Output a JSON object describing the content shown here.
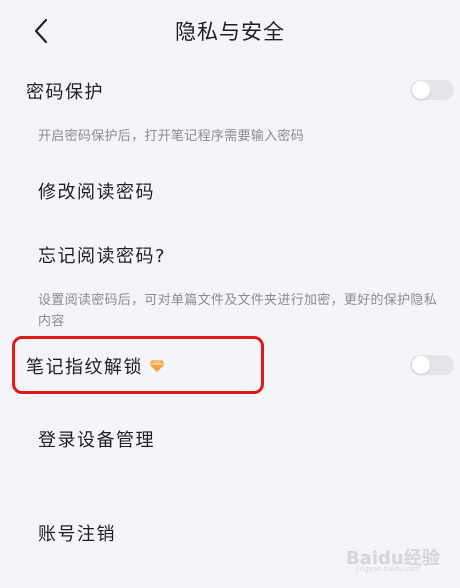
{
  "header": {
    "title": "隐私与安全",
    "back_icon": "chevron-left-icon"
  },
  "items": {
    "password_protection": {
      "label": "密码保护",
      "toggle_on": false,
      "description": "开启密码保护后，打开笔记程序需要输入密码"
    },
    "change_read_password": {
      "label": "修改阅读密码"
    },
    "forgot_read_password": {
      "label": "忘记阅读密码?",
      "description": "设置阅读密码后，可对单篇文件及文件夹进行加密，更好的保护隐私内容"
    },
    "fingerprint_unlock": {
      "label": "笔记指纹解锁",
      "badge_icon": "vip-diamond-icon",
      "toggle_on": false
    },
    "device_management": {
      "label": "登录设备管理"
    },
    "account_cancel": {
      "label": "账号注销"
    }
  },
  "watermark": {
    "text": "Baidu经验",
    "sub": "jingyan.baidu.com"
  },
  "colors": {
    "background": "#f4f5f9",
    "highlight": "#e01818",
    "badge": "#f5a23c",
    "toggle_off": "#e4e5ea"
  }
}
